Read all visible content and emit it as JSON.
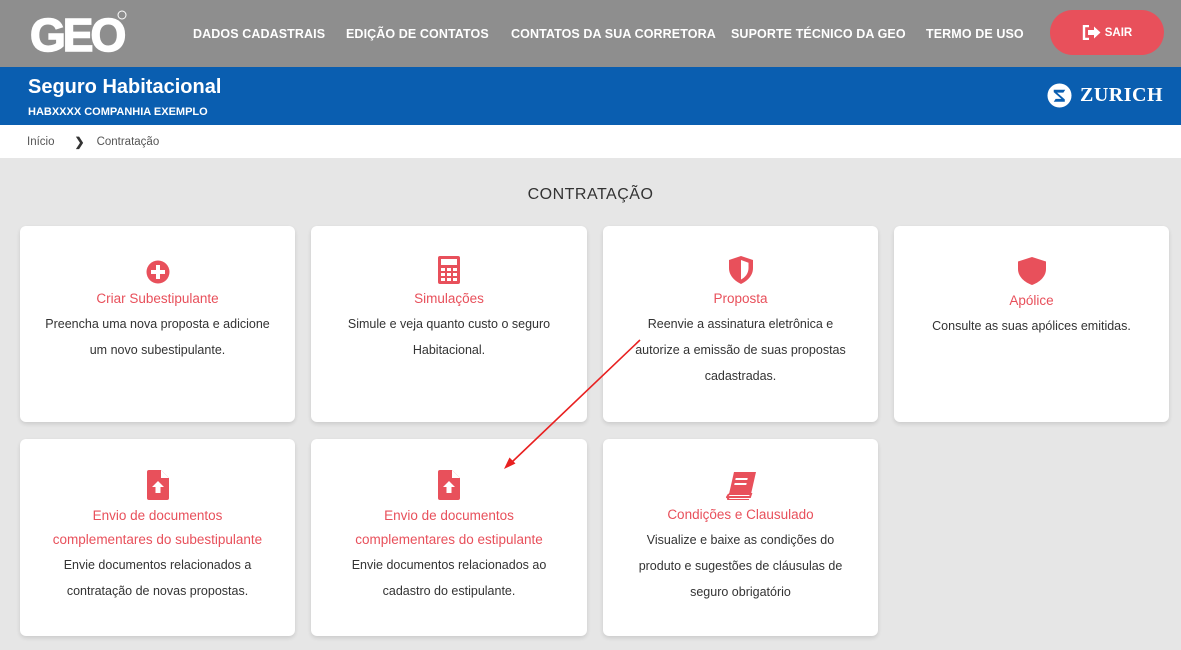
{
  "header": {
    "logo_text": "GEO",
    "nav": [
      "DADOS CADASTRAIS",
      "EDIÇÃO DE CONTATOS",
      "CONTATOS DA SUA CORRETORA",
      "SUPORTE TÉCNICO DA GEO",
      "TERMO DE USO"
    ],
    "logout_label": "SAIR"
  },
  "product": {
    "title": "Seguro Habitacional",
    "company": "HABXXXX COMPANHIA EXEMPLO",
    "insurer": "ZURICH"
  },
  "breadcrumb": [
    "Início",
    "Contratação"
  ],
  "page_title": "CONTRATAÇÃO",
  "cards": [
    {
      "icon": "plus-circle-icon",
      "title": "Criar Subestipulante",
      "desc": [
        "Preencha uma nova proposta e adicione",
        "um novo subestipulante."
      ]
    },
    {
      "icon": "calculator-icon",
      "title": "Simulações",
      "desc": [
        "Simule e veja quanto custo o seguro",
        "Habitacional."
      ]
    },
    {
      "icon": "shield-half-icon",
      "title": "Proposta",
      "desc": [
        "Reenvie a assinatura eletrônica e",
        "autorize a emissão de suas propostas",
        "cadastradas."
      ]
    },
    {
      "icon": "shield-icon",
      "title": "Apólice",
      "desc": [
        "Consulte as suas apólices emitidas."
      ]
    },
    {
      "icon": "file-upload-icon",
      "title": [
        "Envio de documentos",
        "complementares do subestipulante"
      ],
      "desc": [
        "Envie documentos relacionados a",
        "contratação de novas propostas."
      ]
    },
    {
      "icon": "file-upload-icon",
      "title": [
        "Envio de documentos",
        "complementares do estipulante"
      ],
      "desc": [
        "Envie documentos relacionados ao",
        "cadastro do estipulante."
      ]
    },
    {
      "icon": "book-icon",
      "title": "Condições e Clausulado",
      "desc": [
        "Visualize e baixe as condições do",
        "produto e sugestões de cláusulas de",
        "seguro obrigatório"
      ]
    }
  ],
  "colors": {
    "accent": "#e8505b",
    "blue": "#0a5eb0",
    "topbar": "#8e8e8e"
  }
}
